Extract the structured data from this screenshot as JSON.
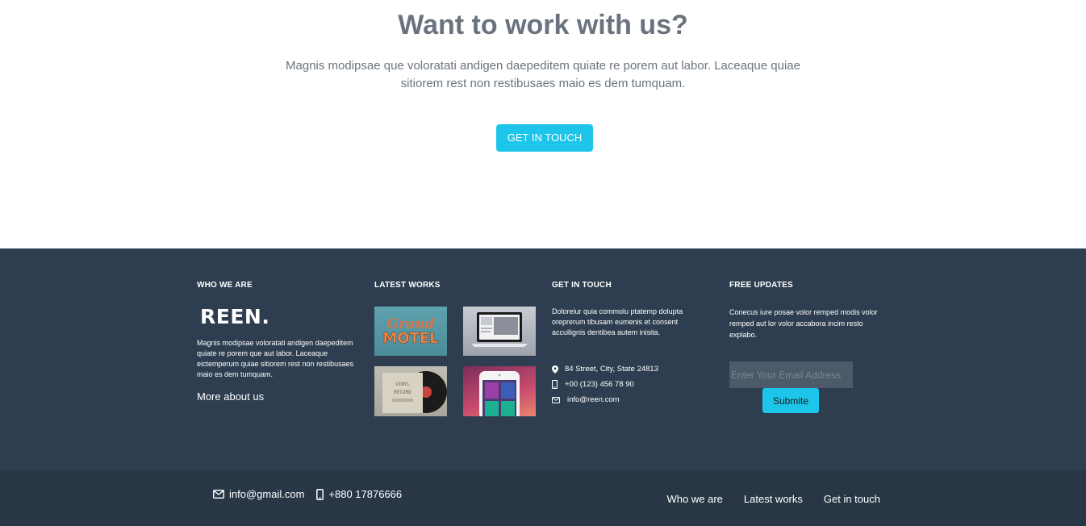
{
  "cta": {
    "title": "Want to work with us?",
    "text": "Magnis modipsae que voloratati andigen daepeditem quiate re porem aut labor. Laceaque quiae sitiorem rest non restibusaes maio es dem tumquam.",
    "button_label": "GET IN TOUCH",
    "button_color": "#1ec5ea"
  },
  "footer": {
    "background": "#2e3e50",
    "who_we_are": {
      "heading": "WHO WE ARE",
      "logo": "REEN.",
      "text": "Magnis modipsae voloratati andigen daepeditem quiate re porem que aut labor. Laceaque eictemperum quiae sitiorem rest non restibusaes maio es dem tumquam.",
      "link": "More about us"
    },
    "latest_works": {
      "heading": "LATEST WORKS",
      "thumbs": [
        {
          "name": "grand-motel-thumb",
          "text_1": "Grand",
          "text_2": "MOTEL"
        },
        {
          "name": "laptop-thumb"
        },
        {
          "name": "vinyl-record-thumb",
          "text_1": "VINYL",
          "text_2": "RECORD"
        },
        {
          "name": "mobile-app-thumb"
        }
      ]
    },
    "get_in_touch": {
      "heading": "GET IN TOUCH",
      "text": "Doloreiur quia commolu ptatemp dolupta oreprerum tibusam eumenis et consent accullignis dentibea autem inisita.",
      "address": "84 Street, City, State 24813",
      "phone": "+00 (123) 456 78 90",
      "email": "info@reen.com"
    },
    "free_updates": {
      "heading": "FREE UPDATES",
      "text": "Conecus iure posae volor remped modis volor remped aut lor volor accabora incim resto explabo.",
      "email_placeholder": "Enter Your Email Address",
      "submit_label": "Submite"
    }
  },
  "bottom_bar": {
    "background": "#283646",
    "email": "info@gmail.com",
    "phone": "+880 17876666",
    "nav": [
      "Who we are",
      "Latest works",
      "Get in touch"
    ]
  }
}
